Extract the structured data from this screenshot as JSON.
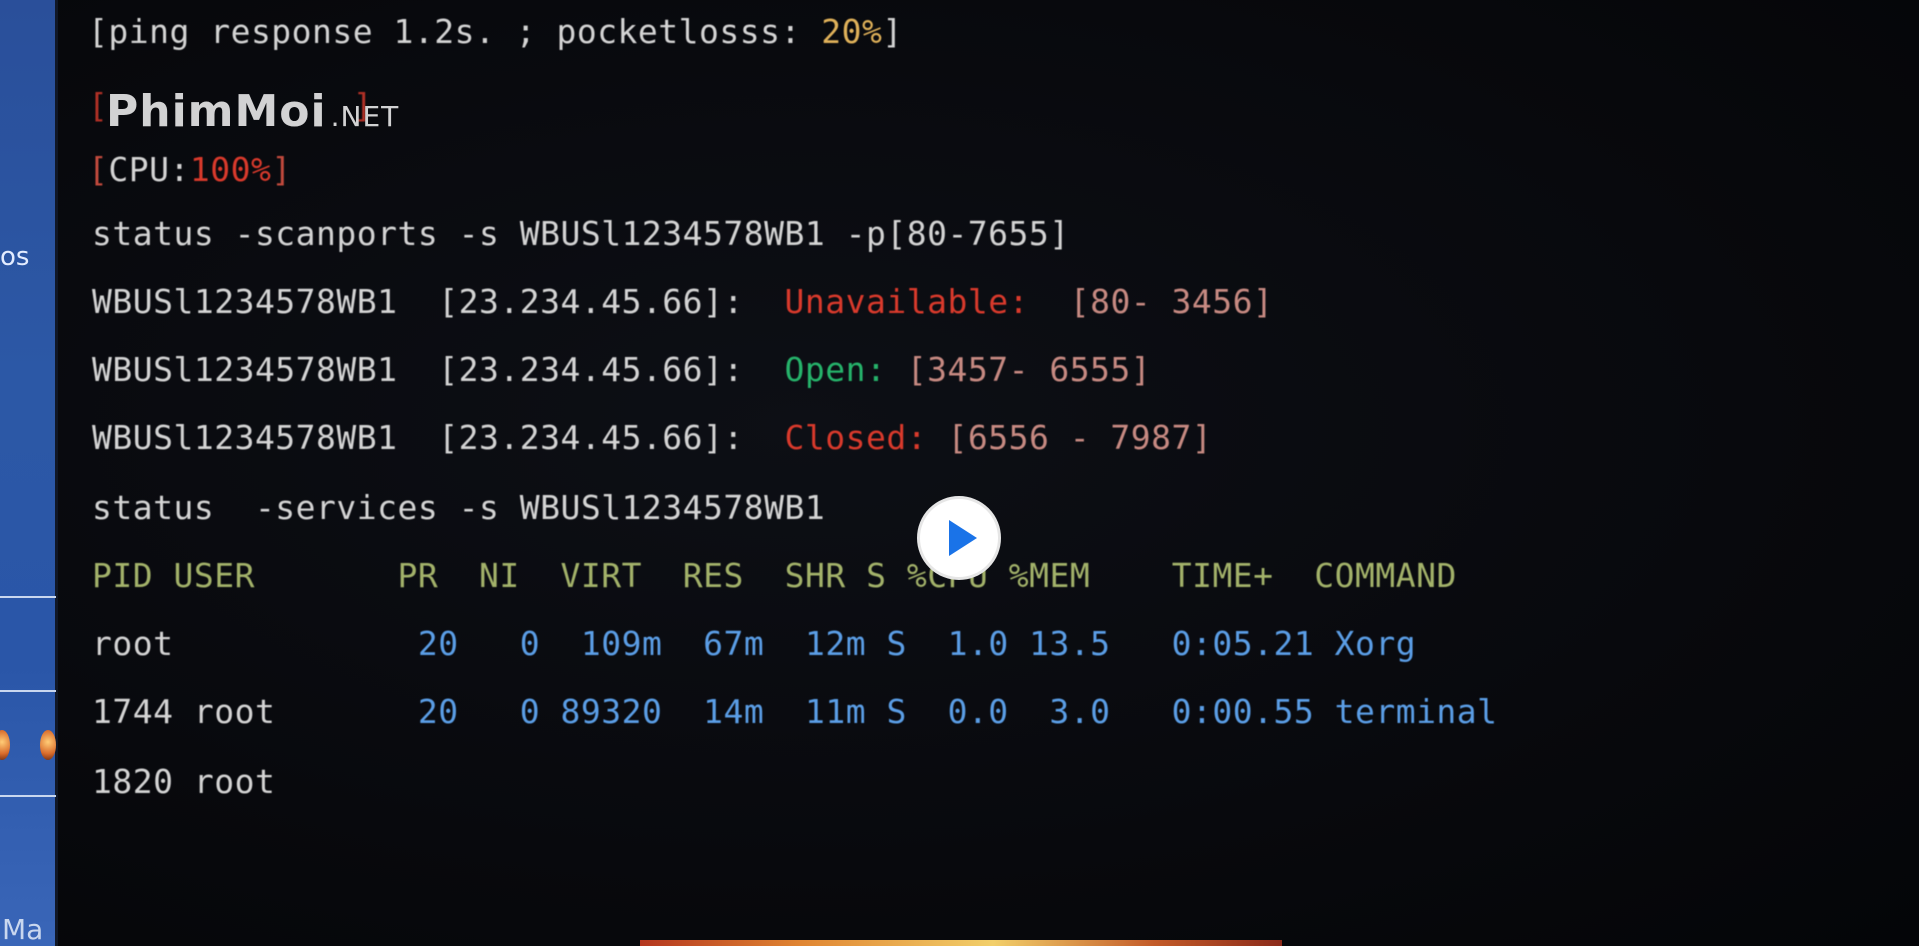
{
  "sidebar": {
    "fragment_text": "os",
    "bottom_label": "Ma"
  },
  "watermark": {
    "brand": "PhimMoi",
    "suffix": ".NET"
  },
  "terminal": {
    "ping": {
      "prefix": "[ping response 1.2s. ; pocketlosss: ",
      "value": "20%",
      "suffix": "]"
    },
    "cpu": {
      "open": "[",
      "label": "CPU:",
      "value": "100%",
      "close": "]"
    },
    "scan_command": "status -scanports -s WBUSl1234578WB1 -p[80-7655]",
    "scan_results": [
      {
        "host": "WBUSl1234578WB1",
        "ip": "[23.234.45.66]:",
        "status": "Unavailable:",
        "range": "[80- 3456]",
        "status_color": "#d93a2c"
      },
      {
        "host": "WBUSl1234578WB1",
        "ip": "[23.234.45.66]:",
        "status": "Open:",
        "range": "[3457- 6555]",
        "status_color": "#26b36b"
      },
      {
        "host": "WBUSl1234578WB1",
        "ip": "[23.234.45.66]:",
        "status": "Closed:",
        "range": "[6556 - 7987]",
        "status_color": "#d93a2c"
      }
    ],
    "services_command": "status  -services -s WBUSl1234578WB1",
    "process_table": {
      "headers": [
        "PID",
        "USER",
        "PR",
        "NI",
        "VIRT",
        "RES",
        "SHR",
        "S",
        "%CPU",
        "%MEM",
        "TIME+",
        "COMMAND"
      ],
      "rows": [
        {
          "pid_user": "root",
          "pr": "20",
          "ni": "0",
          "virt": "109m",
          "res": "67m",
          "shr": "12m",
          "s": "S",
          "cpu": "1.0",
          "mem": "13.5",
          "time": "0:05.21",
          "command": "Xorg"
        },
        {
          "pid_user": "1744 root",
          "pr": "20",
          "ni": "0",
          "virt": "89320",
          "res": "14m",
          "shr": "11m",
          "s": "S",
          "cpu": "0.0",
          "mem": "3.0",
          "time": "0:00.55",
          "command": "terminal"
        },
        {
          "pid_user": "1820 root"
        }
      ]
    }
  },
  "player": {
    "play_icon": "play-icon",
    "accent_color": "#1a73e8"
  }
}
